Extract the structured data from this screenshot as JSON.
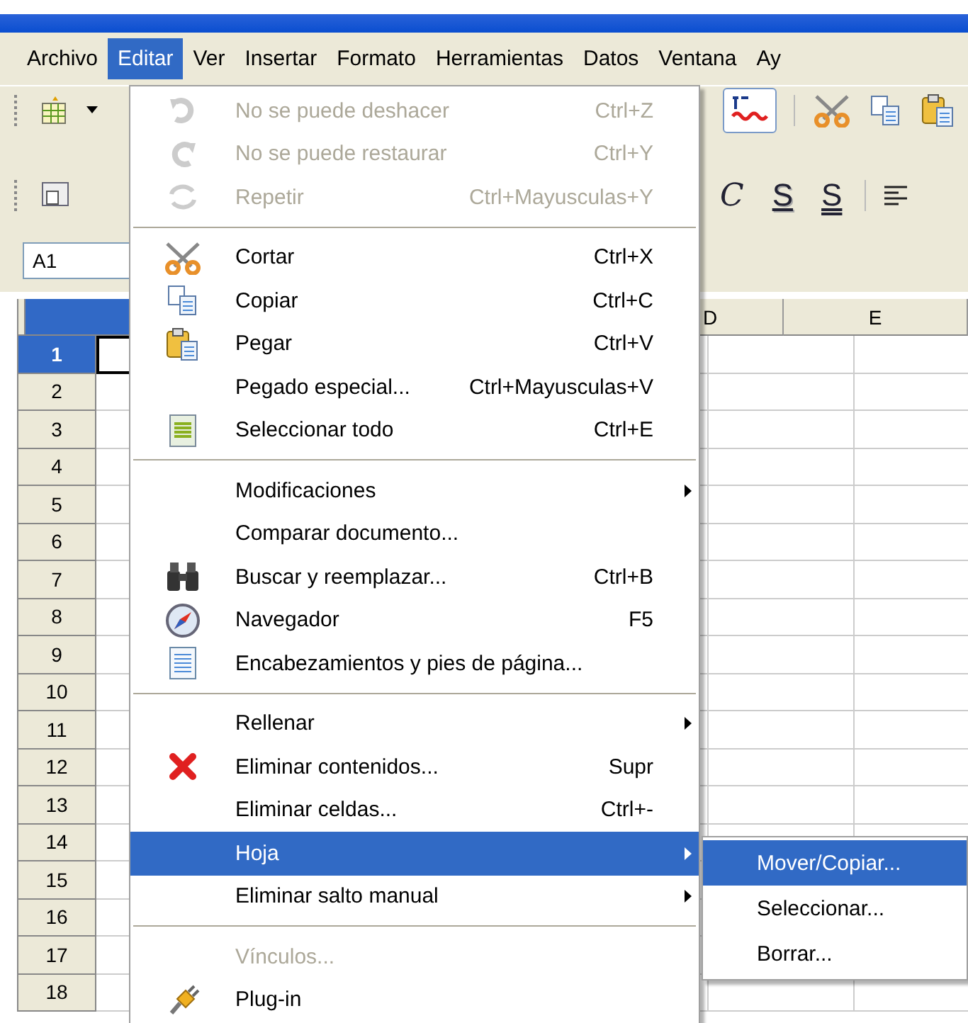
{
  "menu_bar": [
    {
      "label": "Archivo",
      "selected": false
    },
    {
      "label": "Editar",
      "selected": true
    },
    {
      "label": "Ver",
      "selected": false
    },
    {
      "label": "Insertar",
      "selected": false
    },
    {
      "label": "Formato",
      "selected": false
    },
    {
      "label": "Herramientas",
      "selected": false
    },
    {
      "label": "Datos",
      "selected": false
    },
    {
      "label": "Ventana",
      "selected": false
    },
    {
      "label": "Ay",
      "selected": false
    }
  ],
  "format_toolbar": {
    "buttons": [
      "C",
      "S",
      "S"
    ]
  },
  "name_box": {
    "value": "A1"
  },
  "sheet": {
    "columns": [
      {
        "selected": true
      },
      {
        "label": "D",
        "selected": false
      },
      {
        "label": "E",
        "selected": false
      }
    ],
    "rows": [
      {
        "label": "1",
        "selected": true
      },
      {
        "label": "2",
        "selected": false
      },
      {
        "label": "3",
        "selected": false
      },
      {
        "label": "4",
        "selected": false
      },
      {
        "label": "5",
        "selected": false
      },
      {
        "label": "6",
        "selected": false
      },
      {
        "label": "7",
        "selected": false
      },
      {
        "label": "8",
        "selected": false
      },
      {
        "label": "9",
        "selected": false
      },
      {
        "label": "10",
        "selected": false
      },
      {
        "label": "11",
        "selected": false
      },
      {
        "label": "12",
        "selected": false
      },
      {
        "label": "13",
        "selected": false
      },
      {
        "label": "14",
        "selected": false
      },
      {
        "label": "15",
        "selected": false
      },
      {
        "label": "16",
        "selected": false
      },
      {
        "label": "17",
        "selected": false
      },
      {
        "label": "18",
        "selected": false
      }
    ]
  },
  "edit_menu": {
    "sections": [
      [
        {
          "label": "No se puede deshacer",
          "shortcut": "Ctrl+Z",
          "disabled": true,
          "selected": false,
          "submenu": false
        },
        {
          "label": "No se puede restaurar",
          "shortcut": "Ctrl+Y",
          "disabled": true,
          "selected": false,
          "submenu": false
        },
        {
          "label": "Repetir",
          "shortcut": "Ctrl+Mayusculas+Y",
          "disabled": true,
          "selected": false,
          "submenu": false
        }
      ],
      [
        {
          "label": "Cortar",
          "shortcut": "Ctrl+X",
          "disabled": false,
          "selected": false,
          "submenu": false
        },
        {
          "label": "Copiar",
          "shortcut": "Ctrl+C",
          "disabled": false,
          "selected": false,
          "submenu": false
        },
        {
          "label": "Pegar",
          "shortcut": "Ctrl+V",
          "disabled": false,
          "selected": false,
          "submenu": false
        },
        {
          "label": "Pegado especial...",
          "shortcut": "Ctrl+Mayusculas+V",
          "disabled": false,
          "selected": false,
          "submenu": false
        },
        {
          "label": "Seleccionar todo",
          "shortcut": "Ctrl+E",
          "disabled": false,
          "selected": false,
          "submenu": false
        }
      ],
      [
        {
          "label": "Modificaciones",
          "disabled": false,
          "selected": false,
          "submenu": true
        },
        {
          "label": "Comparar documento...",
          "disabled": false,
          "selected": false,
          "submenu": false
        },
        {
          "label": "Buscar y reemplazar...",
          "shortcut": "Ctrl+B",
          "disabled": false,
          "selected": false,
          "submenu": false
        },
        {
          "label": "Navegador",
          "shortcut": "F5",
          "disabled": false,
          "selected": false,
          "submenu": false
        },
        {
          "label": "Encabezamientos y pies de página...",
          "disabled": false,
          "selected": false,
          "submenu": false
        }
      ],
      [
        {
          "label": "Rellenar",
          "disabled": false,
          "selected": false,
          "submenu": true
        },
        {
          "label": "Eliminar contenidos...",
          "shortcut": "Supr",
          "disabled": false,
          "selected": false,
          "submenu": false
        },
        {
          "label": "Eliminar celdas...",
          "shortcut": "Ctrl+-",
          "disabled": false,
          "selected": false,
          "submenu": false
        },
        {
          "label": "Hoja",
          "disabled": false,
          "selected": true,
          "submenu": true
        },
        {
          "label": "Eliminar salto manual",
          "disabled": false,
          "selected": false,
          "submenu": true
        }
      ],
      [
        {
          "label": "Vínculos...",
          "disabled": true,
          "selected": false,
          "submenu": false
        },
        {
          "label": "Plug-in",
          "disabled": false,
          "selected": false,
          "submenu": false
        }
      ]
    ]
  },
  "submenu": {
    "items": [
      {
        "label": "Mover/Copiar...",
        "selected": true
      },
      {
        "label": "Seleccionar...",
        "selected": false
      },
      {
        "label": "Borrar...",
        "selected": false
      }
    ]
  }
}
